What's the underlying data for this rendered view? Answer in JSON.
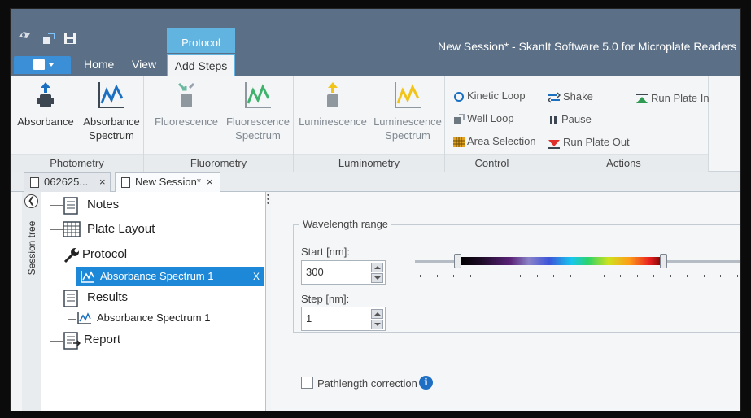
{
  "window": {
    "title": "New Session* - SkanIt Software 5.0 for Microplate Readers",
    "context_tab_header": "Protocol"
  },
  "ribbon_tabs": {
    "home": "Home",
    "view": "View",
    "add_steps": "Add Steps"
  },
  "ribbon": {
    "photometry": {
      "label": "Photometry",
      "absorbance": "Absorbance",
      "absorbance_spectrum_1": "Absorbance",
      "absorbance_spectrum_2": "Spectrum"
    },
    "fluorometry": {
      "label": "Fluorometry",
      "fluorescence": "Fluorescence",
      "fluorescence_spectrum_1": "Fluorescence",
      "fluorescence_spectrum_2": "Spectrum"
    },
    "luminometry": {
      "label": "Luminometry",
      "luminescence": "Luminescence",
      "luminescence_spectrum_1": "Luminescence",
      "luminescence_spectrum_2": "Spectrum"
    },
    "control": {
      "label": "Control",
      "kinetic_loop": "Kinetic Loop",
      "well_loop": "Well Loop",
      "area_selection": "Area Selection"
    },
    "actions": {
      "label": "Actions",
      "shake": "Shake",
      "pause": "Pause",
      "run_plate_out": "Run Plate Out",
      "run_plate_in": "Run Plate In"
    }
  },
  "doc_tabs": [
    {
      "label": "062625...",
      "close": "×"
    },
    {
      "label": "New Session*",
      "close": "×"
    }
  ],
  "session_tree": {
    "label": "Session tree",
    "items": {
      "notes": "Notes",
      "plate_layout": "Plate Layout",
      "protocol": "Protocol",
      "protocol_step": "Absorbance Spectrum 1",
      "protocol_step_close": "X",
      "results": "Results",
      "results_step": "Absorbance Spectrum 1",
      "report": "Report"
    }
  },
  "wavelength": {
    "legend": "Wavelength range",
    "start_label": "Start [nm]:",
    "start_value": "300",
    "step_label": "Step [nm]:",
    "step_value": "1"
  },
  "pathlength": {
    "label": "Pathlength correction",
    "checked": false,
    "info": "i"
  },
  "colors": {
    "titlebar": "#5b6f86",
    "accent": "#1e88d8",
    "context_tab": "#62b4e0"
  }
}
